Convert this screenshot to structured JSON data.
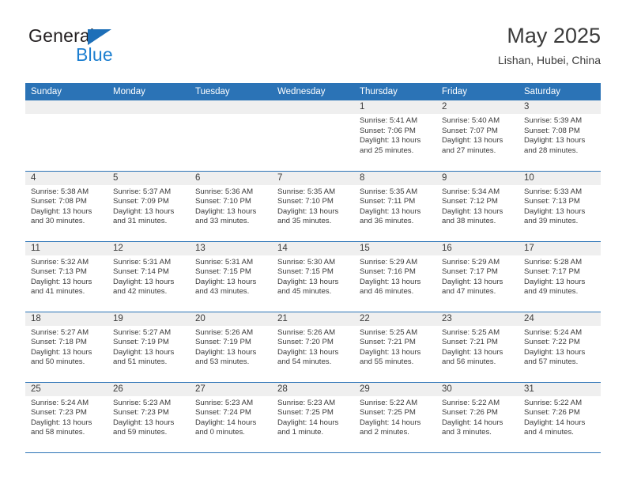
{
  "brand": {
    "name_part1": "General",
    "name_part2": "Blue",
    "triangle_color": "#1d6fb8",
    "blue_color": "#1d7fd0"
  },
  "header": {
    "title": "May 2025",
    "location": "Lishan, Hubei, China"
  },
  "theme": {
    "header_blue": "#2b73b6",
    "daynum_band": "#efefef",
    "grid_line": "#2b73b6",
    "text": "#3a3a3a"
  },
  "weekdays": [
    "Sunday",
    "Monday",
    "Tuesday",
    "Wednesday",
    "Thursday",
    "Friday",
    "Saturday"
  ],
  "weeks": [
    [
      {
        "day": "",
        "sunrise": "",
        "sunset": "",
        "daylight1": "",
        "daylight2": "",
        "empty": true
      },
      {
        "day": "",
        "sunrise": "",
        "sunset": "",
        "daylight1": "",
        "daylight2": "",
        "empty": true
      },
      {
        "day": "",
        "sunrise": "",
        "sunset": "",
        "daylight1": "",
        "daylight2": "",
        "empty": true
      },
      {
        "day": "",
        "sunrise": "",
        "sunset": "",
        "daylight1": "",
        "daylight2": "",
        "empty": true
      },
      {
        "day": "1",
        "sunrise": "Sunrise: 5:41 AM",
        "sunset": "Sunset: 7:06 PM",
        "daylight1": "Daylight: 13 hours",
        "daylight2": "and 25 minutes."
      },
      {
        "day": "2",
        "sunrise": "Sunrise: 5:40 AM",
        "sunset": "Sunset: 7:07 PM",
        "daylight1": "Daylight: 13 hours",
        "daylight2": "and 27 minutes."
      },
      {
        "day": "3",
        "sunrise": "Sunrise: 5:39 AM",
        "sunset": "Sunset: 7:08 PM",
        "daylight1": "Daylight: 13 hours",
        "daylight2": "and 28 minutes."
      }
    ],
    [
      {
        "day": "4",
        "sunrise": "Sunrise: 5:38 AM",
        "sunset": "Sunset: 7:08 PM",
        "daylight1": "Daylight: 13 hours",
        "daylight2": "and 30 minutes."
      },
      {
        "day": "5",
        "sunrise": "Sunrise: 5:37 AM",
        "sunset": "Sunset: 7:09 PM",
        "daylight1": "Daylight: 13 hours",
        "daylight2": "and 31 minutes."
      },
      {
        "day": "6",
        "sunrise": "Sunrise: 5:36 AM",
        "sunset": "Sunset: 7:10 PM",
        "daylight1": "Daylight: 13 hours",
        "daylight2": "and 33 minutes."
      },
      {
        "day": "7",
        "sunrise": "Sunrise: 5:35 AM",
        "sunset": "Sunset: 7:10 PM",
        "daylight1": "Daylight: 13 hours",
        "daylight2": "and 35 minutes."
      },
      {
        "day": "8",
        "sunrise": "Sunrise: 5:35 AM",
        "sunset": "Sunset: 7:11 PM",
        "daylight1": "Daylight: 13 hours",
        "daylight2": "and 36 minutes."
      },
      {
        "day": "9",
        "sunrise": "Sunrise: 5:34 AM",
        "sunset": "Sunset: 7:12 PM",
        "daylight1": "Daylight: 13 hours",
        "daylight2": "and 38 minutes."
      },
      {
        "day": "10",
        "sunrise": "Sunrise: 5:33 AM",
        "sunset": "Sunset: 7:13 PM",
        "daylight1": "Daylight: 13 hours",
        "daylight2": "and 39 minutes."
      }
    ],
    [
      {
        "day": "11",
        "sunrise": "Sunrise: 5:32 AM",
        "sunset": "Sunset: 7:13 PM",
        "daylight1": "Daylight: 13 hours",
        "daylight2": "and 41 minutes."
      },
      {
        "day": "12",
        "sunrise": "Sunrise: 5:31 AM",
        "sunset": "Sunset: 7:14 PM",
        "daylight1": "Daylight: 13 hours",
        "daylight2": "and 42 minutes."
      },
      {
        "day": "13",
        "sunrise": "Sunrise: 5:31 AM",
        "sunset": "Sunset: 7:15 PM",
        "daylight1": "Daylight: 13 hours",
        "daylight2": "and 43 minutes."
      },
      {
        "day": "14",
        "sunrise": "Sunrise: 5:30 AM",
        "sunset": "Sunset: 7:15 PM",
        "daylight1": "Daylight: 13 hours",
        "daylight2": "and 45 minutes."
      },
      {
        "day": "15",
        "sunrise": "Sunrise: 5:29 AM",
        "sunset": "Sunset: 7:16 PM",
        "daylight1": "Daylight: 13 hours",
        "daylight2": "and 46 minutes."
      },
      {
        "day": "16",
        "sunrise": "Sunrise: 5:29 AM",
        "sunset": "Sunset: 7:17 PM",
        "daylight1": "Daylight: 13 hours",
        "daylight2": "and 47 minutes."
      },
      {
        "day": "17",
        "sunrise": "Sunrise: 5:28 AM",
        "sunset": "Sunset: 7:17 PM",
        "daylight1": "Daylight: 13 hours",
        "daylight2": "and 49 minutes."
      }
    ],
    [
      {
        "day": "18",
        "sunrise": "Sunrise: 5:27 AM",
        "sunset": "Sunset: 7:18 PM",
        "daylight1": "Daylight: 13 hours",
        "daylight2": "and 50 minutes."
      },
      {
        "day": "19",
        "sunrise": "Sunrise: 5:27 AM",
        "sunset": "Sunset: 7:19 PM",
        "daylight1": "Daylight: 13 hours",
        "daylight2": "and 51 minutes."
      },
      {
        "day": "20",
        "sunrise": "Sunrise: 5:26 AM",
        "sunset": "Sunset: 7:19 PM",
        "daylight1": "Daylight: 13 hours",
        "daylight2": "and 53 minutes."
      },
      {
        "day": "21",
        "sunrise": "Sunrise: 5:26 AM",
        "sunset": "Sunset: 7:20 PM",
        "daylight1": "Daylight: 13 hours",
        "daylight2": "and 54 minutes."
      },
      {
        "day": "22",
        "sunrise": "Sunrise: 5:25 AM",
        "sunset": "Sunset: 7:21 PM",
        "daylight1": "Daylight: 13 hours",
        "daylight2": "and 55 minutes."
      },
      {
        "day": "23",
        "sunrise": "Sunrise: 5:25 AM",
        "sunset": "Sunset: 7:21 PM",
        "daylight1": "Daylight: 13 hours",
        "daylight2": "and 56 minutes."
      },
      {
        "day": "24",
        "sunrise": "Sunrise: 5:24 AM",
        "sunset": "Sunset: 7:22 PM",
        "daylight1": "Daylight: 13 hours",
        "daylight2": "and 57 minutes."
      }
    ],
    [
      {
        "day": "25",
        "sunrise": "Sunrise: 5:24 AM",
        "sunset": "Sunset: 7:23 PM",
        "daylight1": "Daylight: 13 hours",
        "daylight2": "and 58 minutes."
      },
      {
        "day": "26",
        "sunrise": "Sunrise: 5:23 AM",
        "sunset": "Sunset: 7:23 PM",
        "daylight1": "Daylight: 13 hours",
        "daylight2": "and 59 minutes."
      },
      {
        "day": "27",
        "sunrise": "Sunrise: 5:23 AM",
        "sunset": "Sunset: 7:24 PM",
        "daylight1": "Daylight: 14 hours",
        "daylight2": "and 0 minutes."
      },
      {
        "day": "28",
        "sunrise": "Sunrise: 5:23 AM",
        "sunset": "Sunset: 7:25 PM",
        "daylight1": "Daylight: 14 hours",
        "daylight2": "and 1 minute."
      },
      {
        "day": "29",
        "sunrise": "Sunrise: 5:22 AM",
        "sunset": "Sunset: 7:25 PM",
        "daylight1": "Daylight: 14 hours",
        "daylight2": "and 2 minutes."
      },
      {
        "day": "30",
        "sunrise": "Sunrise: 5:22 AM",
        "sunset": "Sunset: 7:26 PM",
        "daylight1": "Daylight: 14 hours",
        "daylight2": "and 3 minutes."
      },
      {
        "day": "31",
        "sunrise": "Sunrise: 5:22 AM",
        "sunset": "Sunset: 7:26 PM",
        "daylight1": "Daylight: 14 hours",
        "daylight2": "and 4 minutes."
      }
    ]
  ]
}
